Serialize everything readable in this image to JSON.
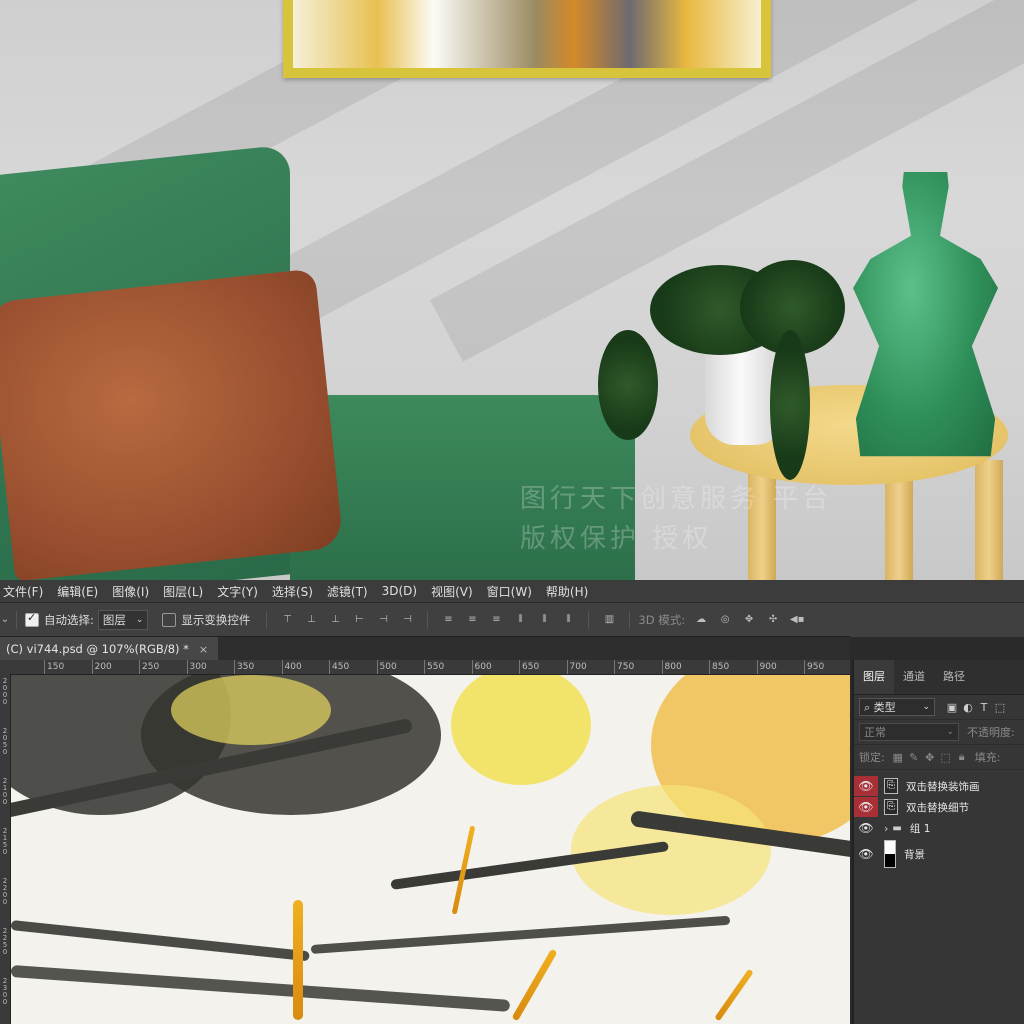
{
  "watermark": {
    "line1": "图行天下创意服务 平台",
    "line2": "版权保护 授权"
  },
  "menu": {
    "items": [
      "文件(F)",
      "编辑(E)",
      "图像(I)",
      "图层(L)",
      "文字(Y)",
      "选择(S)",
      "滤镜(T)",
      "3D(D)",
      "视图(V)",
      "窗口(W)",
      "帮助(H)"
    ]
  },
  "options": {
    "auto_select_label": "自动选择:",
    "auto_select_checked": true,
    "auto_select_target": "图层",
    "show_transform_label": "显示变换控件",
    "show_transform_checked": false,
    "mode_3d_label": "3D 模式:"
  },
  "document": {
    "tab_title": "(C) vi744.psd @ 107%(RGB/8) *",
    "close_glyph": "×"
  },
  "ruler": {
    "h_labels": [
      "150",
      "200",
      "250",
      "300",
      "350",
      "400",
      "450",
      "500",
      "550",
      "600",
      "650",
      "700",
      "750",
      "800",
      "850",
      "900",
      "950"
    ],
    "v_labels": [
      "2000",
      "2050",
      "2100",
      "2150",
      "2200",
      "2250",
      "2300"
    ]
  },
  "layers_panel": {
    "tabs": [
      "图层",
      "通道",
      "路径"
    ],
    "active_tab": "图层",
    "filter_label": "类型",
    "blend_mode": "正常",
    "opacity_label": "不透明度:",
    "lock_label": "锁定:",
    "fill_label": "填充:",
    "layers": [
      {
        "name": "双击替换装饰画",
        "type": "smart",
        "visible": true,
        "selected": true
      },
      {
        "name": "双击替换细节",
        "type": "smart",
        "visible": true,
        "selected": true
      },
      {
        "name": "组 1",
        "type": "group",
        "visible": true,
        "selected": false
      },
      {
        "name": "背景",
        "type": "background",
        "visible": true,
        "selected": false
      }
    ]
  }
}
